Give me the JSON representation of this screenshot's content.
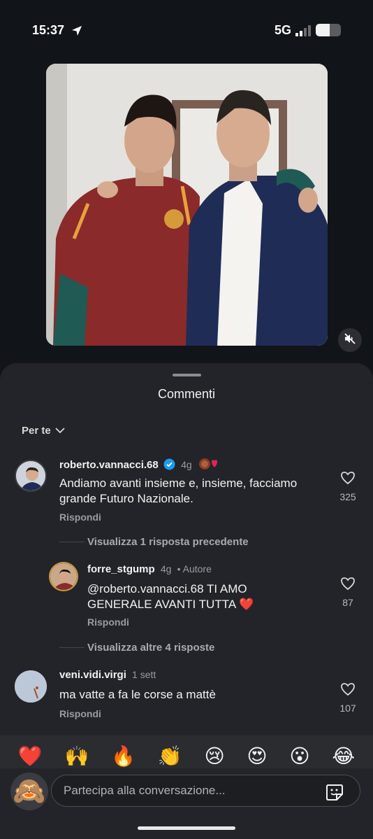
{
  "status": {
    "time": "15:37",
    "network": "5G",
    "battery_level": 0.55
  },
  "media": {
    "mute_icon": "speaker-muted-icon"
  },
  "sheet": {
    "title": "Commenti",
    "sort_label": "Per te"
  },
  "comments": [
    {
      "user": "roberto.vannacci.68",
      "verified": true,
      "time": "4g",
      "text_line1": "Andiamo avanti insieme e, insieme, facciamo",
      "text_line2": "grande Futuro Nazionale.",
      "reply_label": "Rispondi",
      "likes": "325"
    },
    {
      "user": "forre_stgump",
      "time": "4g",
      "author_tag": "• Autore",
      "text_line1": "@roberto.vannacci.68 TI AMO",
      "text_line2": "GENERALE AVANTI TUTTA ❤️",
      "reply_label": "Rispondi",
      "likes": "87"
    },
    {
      "user": "veni.vidi.virgi",
      "time": "1 sett",
      "text_line1": "ma vatte a fa le corse a mattè",
      "reply_label": "Rispondi",
      "likes": "107"
    }
  ],
  "threads": {
    "prev_replies": "Visualizza 1 risposta precedente",
    "more_replies": "Visualizza altre 4 risposte"
  },
  "emojis": [
    "❤️",
    "🙌",
    "🔥",
    "👏",
    "😢",
    "😍",
    "😮",
    "😂"
  ],
  "composer": {
    "placeholder": "Partecipa alla conversazione...",
    "avatar_emoji": "🙈"
  },
  "colors": {
    "background": "#111418",
    "sheet": "#222429",
    "verified": "#1d9bf0",
    "heart": "#e0245e"
  }
}
